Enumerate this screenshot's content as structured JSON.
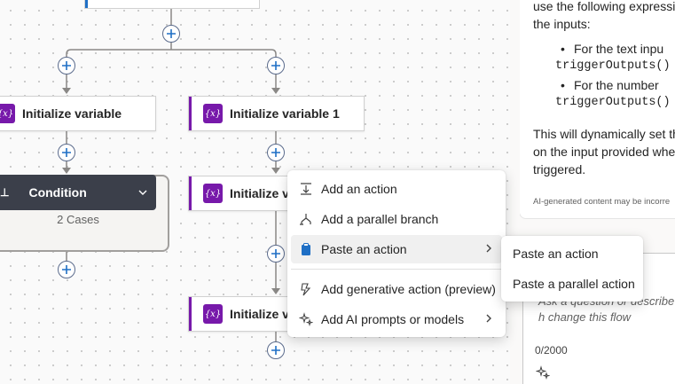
{
  "canvas": {
    "action1_title": "Initialize variable",
    "action2_title": "Initialize variable 1",
    "action3_title": "Initialize v",
    "action4_title": "Initialize v",
    "variable_icon_text": "{x}",
    "condition_title": "Condition",
    "condition_cases": "2 Cases"
  },
  "context_menu": {
    "items": [
      {
        "label": "Add an action",
        "icon": "add-action-icon"
      },
      {
        "label": "Add a parallel branch",
        "icon": "parallel-branch-icon"
      },
      {
        "label": "Paste an action",
        "icon": "clipboard-icon",
        "has_submenu": true
      },
      {
        "label": "Add generative action (preview)",
        "icon": "generative-action-icon"
      },
      {
        "label": "Add AI prompts or models",
        "icon": "ai-sparkle-icon",
        "has_submenu": true
      }
    ]
  },
  "submenu": {
    "items": [
      {
        "label": "Paste an action"
      },
      {
        "label": "Paste a parallel action"
      }
    ]
  },
  "copilot_panel": {
    "line1": "use the following expressi",
    "line2": "the inputs:",
    "bullet1": "For the text inpu",
    "code1": "triggerOutputs()",
    "bullet2": "For the number",
    "code2": "triggerOutputs()",
    "para1": "This will dynamically set th",
    "para2": "on the input provided whe",
    "para3": "triggered.",
    "disclaimer": "AI-generated content may be incorre",
    "input_placeholder": "Ask a question or describe h change this flow",
    "char_count": "0/2000"
  },
  "colors": {
    "variable_accent": "#7719aa",
    "trigger_accent": "#1f6fc5",
    "condition_header": "#3b3f4a"
  }
}
